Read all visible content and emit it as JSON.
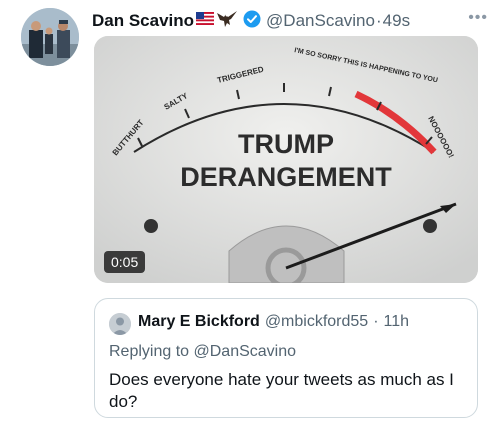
{
  "tweet": {
    "author_name": "Dan Scavino",
    "handle": "@DanScavino",
    "separator": "·",
    "time": "49s",
    "flag_icon": "us-flag-icon",
    "eagle_icon": "eagle-icon",
    "verified_icon": "verified-badge-icon",
    "more_icon": "more-icon",
    "more_label": "•••"
  },
  "media": {
    "duration": "0:05",
    "meter_title_line1": "TRUMP",
    "meter_title_line2": "DERANGEMENT",
    "scale_labels": [
      "BUTTHURT",
      "SALTY",
      "TRIGGERED",
      "I'M SO SORRY THIS IS HAPPENING TO YOU",
      "NOOOOOO!"
    ],
    "accent_red": "#e2373a"
  },
  "quote": {
    "author_name": "Mary E Bickford",
    "handle": "@mbickford55",
    "separator": "·",
    "time": "11h",
    "replying_prefix": "Replying to",
    "replying_handle": "@DanScavino",
    "text": "Does everyone hate your tweets as much as I do?"
  }
}
